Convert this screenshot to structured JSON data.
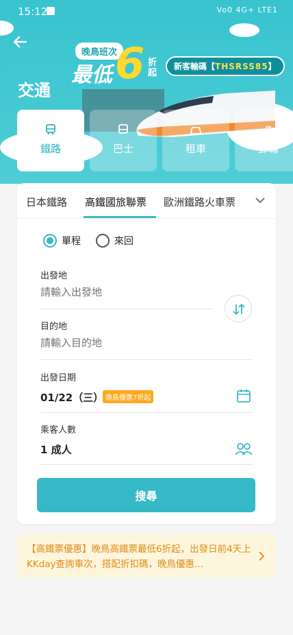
{
  "status_bar": {
    "time": "15:12",
    "indicators": "Vo0 4G+ LTE1"
  },
  "header": {
    "title": "交通",
    "back_icon": "arrow-left-icon"
  },
  "banner": {
    "tag": "晚鳥班次",
    "headline": "最低",
    "number": "6",
    "suffix": "折起",
    "coupon_prefix": "新客輸碼【",
    "coupon_code": "THSRSS85",
    "coupon_suffix": "】"
  },
  "categories": [
    {
      "label": "鐵路",
      "icon": "train-icon",
      "active": true
    },
    {
      "label": "巴士",
      "icon": "bus-icon",
      "active": false
    },
    {
      "label": "租車",
      "icon": "car-icon",
      "active": false
    },
    {
      "label": "郵輪",
      "icon": "ship-icon",
      "active": false
    }
  ],
  "tabs": [
    {
      "label": "日本鐵路"
    },
    {
      "label": "高鐵國旅聯票",
      "active": true
    },
    {
      "label": "歐洲鐵路火車票"
    }
  ],
  "trip_type": {
    "one_way": "單程",
    "round_trip": "來回",
    "selected": "one_way"
  },
  "form": {
    "departure": {
      "label": "出發地",
      "placeholder": "請輸入出發地"
    },
    "destination": {
      "label": "目的地",
      "placeholder": "請輸入目的地"
    },
    "date": {
      "label": "出發日期",
      "value": "01/22（三）",
      "badge": "晚鳥優惠7折起"
    },
    "passengers": {
      "label": "乘客人數",
      "value": "1 成人"
    },
    "search_label": "搜尋"
  },
  "notice": {
    "text": "【高鐵票優惠】晚鳥高鐵票最低6折起，出發日前4天上KKday查詢車次，搭配折扣碼，晚鳥優惠..."
  },
  "colors": {
    "accent": "#35b9c6",
    "promo_yellow": "#ffd92e",
    "notice_bg": "#fdf6dc",
    "notice_text": "#e08a1a"
  }
}
